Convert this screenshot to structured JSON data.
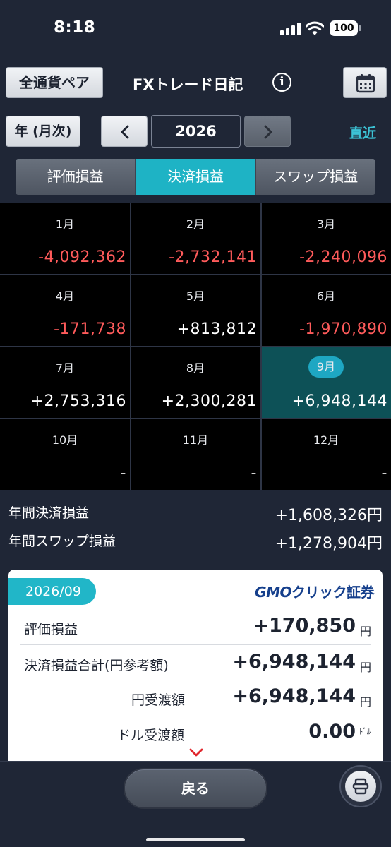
{
  "status_bar": {
    "time": "8:18",
    "battery": "100"
  },
  "header": {
    "all_pairs_label": "全通貨ペア",
    "title": "FXトレード日記",
    "info_label": "i"
  },
  "year_controls": {
    "mode_label": "年 (月次)",
    "year": "2026",
    "recent_label": "直近"
  },
  "tabs": [
    {
      "label": "評価損益",
      "active": false
    },
    {
      "label": "決済損益",
      "active": true
    },
    {
      "label": "スワップ損益",
      "active": false
    }
  ],
  "months": [
    {
      "label": "1月",
      "value": "-4,092,362",
      "sign": "neg"
    },
    {
      "label": "2月",
      "value": "-2,732,141",
      "sign": "neg"
    },
    {
      "label": "3月",
      "value": "-2,240,096",
      "sign": "neg"
    },
    {
      "label": "4月",
      "value": "-171,738",
      "sign": "neg"
    },
    {
      "label": "5月",
      "value": "+813,812",
      "sign": "pos"
    },
    {
      "label": "6月",
      "value": "-1,970,890",
      "sign": "neg"
    },
    {
      "label": "7月",
      "value": "+2,753,316",
      "sign": "pos"
    },
    {
      "label": "8月",
      "value": "+2,300,281",
      "sign": "pos"
    },
    {
      "label": "9月",
      "value": "+6,948,144",
      "sign": "pos",
      "selected": true
    },
    {
      "label": "10月",
      "value": "-",
      "sign": "pos"
    },
    {
      "label": "11月",
      "value": "-",
      "sign": "pos"
    },
    {
      "label": "12月",
      "value": "-",
      "sign": "pos"
    }
  ],
  "annual": {
    "settlement_label": "年間決済損益",
    "settlement_value": "+1,608,326円",
    "swap_label": "年間スワップ損益",
    "swap_value": "+1,278,904円"
  },
  "detail_card": {
    "date": "2026/09",
    "logo_gmo": "GMO",
    "logo_text": "クリック証券",
    "rows": [
      {
        "label": "評価損益",
        "value": "+170,850",
        "unit": "円"
      },
      {
        "label": "決済損益合計(円参考額)",
        "value": "+6,948,144",
        "unit": "円"
      },
      {
        "label": "円受渡額",
        "value": "+6,948,144",
        "unit": "円"
      },
      {
        "label": "ドル受渡額",
        "value": "0.00",
        "unit": "ﾄﾞﾙ"
      }
    ]
  },
  "bottom": {
    "back_label": "戻る"
  },
  "colors": {
    "accent": "#1eb3c5",
    "negative": "#ff5b5b",
    "background": "#1f2636",
    "grid": "#000000"
  }
}
